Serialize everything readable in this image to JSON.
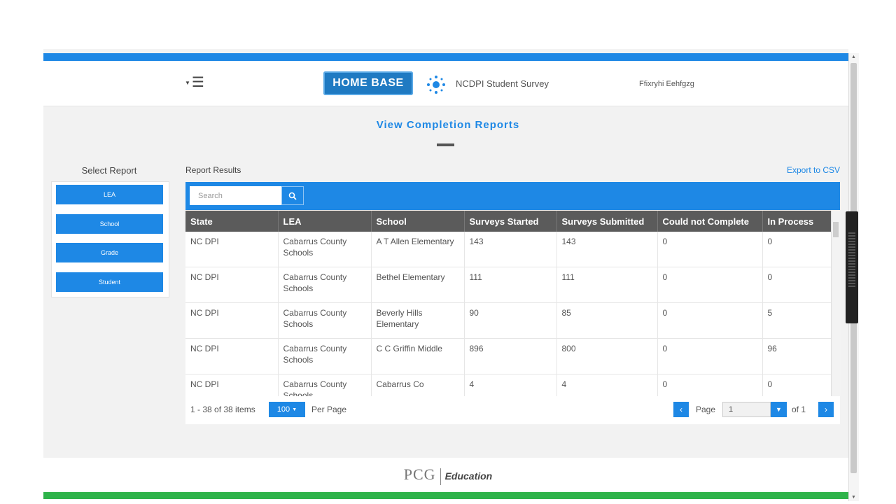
{
  "header": {
    "menu_icon": "hamburger-menu-icon",
    "logo_text": "HOME BASE",
    "app_title": "NCDPI Student Survey",
    "username": "Ffixryhi Eehfgzg"
  },
  "page": {
    "title": "View Completion Reports"
  },
  "sidebar": {
    "label": "Select Report",
    "items": [
      {
        "label": "LEA"
      },
      {
        "label": "School"
      },
      {
        "label": "Grade"
      },
      {
        "label": "Student"
      }
    ]
  },
  "results": {
    "label": "Report Results",
    "export_label": "Export to CSV",
    "search_placeholder": "Search",
    "columns": [
      "State",
      "LEA",
      "School",
      "Surveys Started",
      "Surveys Submitted",
      "Could not Complete",
      "In Process"
    ],
    "rows": [
      [
        "NC DPI",
        "Cabarrus County Schools",
        "A T Allen Elementary",
        "143",
        "143",
        "0",
        "0"
      ],
      [
        "NC DPI",
        "Cabarrus County Schools",
        "Bethel Elementary",
        "111",
        "111",
        "0",
        "0"
      ],
      [
        "NC DPI",
        "Cabarrus County Schools",
        "Beverly Hills Elementary",
        "90",
        "85",
        "0",
        "5"
      ],
      [
        "NC DPI",
        "Cabarrus County Schools",
        "C C Griffin Middle",
        "896",
        "800",
        "0",
        "96"
      ],
      [
        "NC DPI",
        "Cabarrus County Schools",
        "Cabarrus Co",
        "4",
        "4",
        "0",
        "0"
      ]
    ]
  },
  "pager": {
    "count_text": "1 - 38 of 38 items",
    "per_page_value": "100",
    "per_page_label": "Per Page",
    "page_label": "Page",
    "page_value": "1",
    "of_text": "of 1"
  },
  "footer": {
    "brand": "PCG",
    "brand_sub": "Education"
  },
  "colors": {
    "accent": "#1e88e5",
    "header_row": "#5b5b5b",
    "footer_bar": "#2eb34a"
  }
}
